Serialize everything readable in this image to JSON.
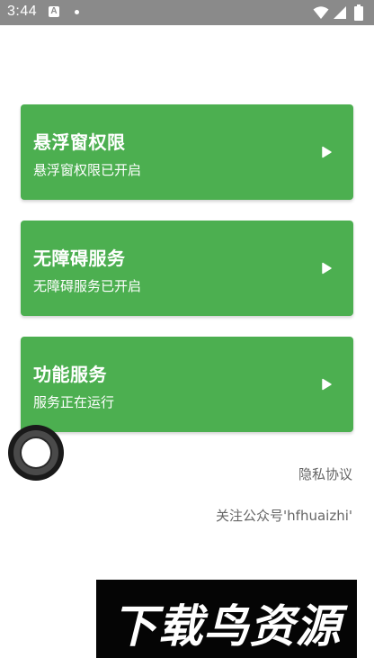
{
  "status_bar": {
    "time": "3:44",
    "app_icon_letter": "A",
    "icons": [
      "notification-dot-icon",
      "wifi-icon",
      "cellular-signal-icon",
      "battery-icon"
    ]
  },
  "cards": [
    {
      "title": "悬浮窗权限",
      "subtitle": "悬浮窗权限已开启",
      "icon": "play-arrow-icon"
    },
    {
      "title": "无障碍服务",
      "subtitle": "无障碍服务已开启",
      "icon": "play-arrow-icon"
    },
    {
      "title": "功能服务",
      "subtitle": "服务正在运行",
      "icon": "play-arrow-icon"
    }
  ],
  "links": {
    "privacy": "隐私协议",
    "follow": "关注公众号'hfhuaizhi'"
  },
  "watermark": {
    "text": "下载鸟资源"
  },
  "colors": {
    "card_green": "#4caf50",
    "status_bar": "#8a8a8a",
    "link_text": "#666666"
  }
}
